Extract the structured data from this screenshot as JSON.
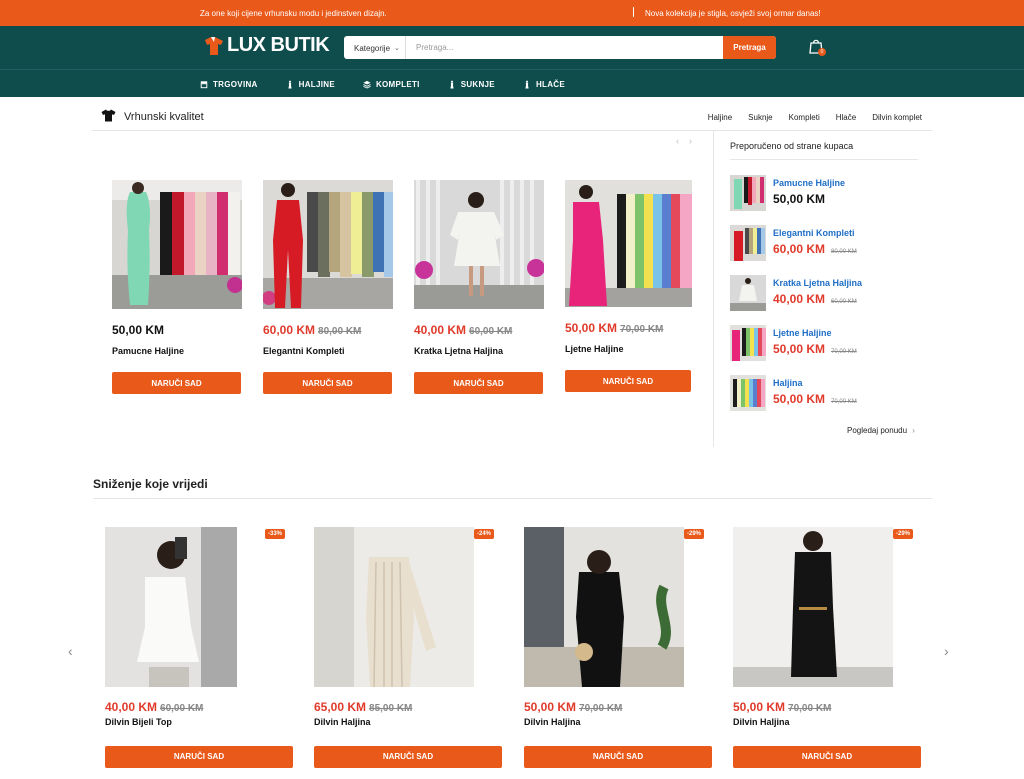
{
  "topbar": {
    "left": "Za one koji cijene vrhunsku modu i jedinstven dizajn.",
    "right": "Nova kolekcija je stigla, osvježi svoj ormar danas!"
  },
  "header": {
    "logo": "LUX BUTIK",
    "category_label": "Kategorije",
    "search_placeholder": "Pretraga...",
    "search_button": "Pretraga",
    "cart_count": "0"
  },
  "nav": {
    "items": [
      "TRGOVINA",
      "HALJINE",
      "KOMPLETI",
      "SUKNJE",
      "HLAČE"
    ]
  },
  "section1": {
    "title": "Vrhunski kvalitet",
    "tabs": [
      "Haljine",
      "Suknje",
      "Kompleti",
      "Hlače",
      "Dilvin komplet"
    ],
    "products": [
      {
        "price": "50,00 KM",
        "old": "",
        "name": "Pamucne Haljine",
        "button": "NARUČI SAD"
      },
      {
        "price": "60,00 KM",
        "old": "80,00 KM",
        "name": "Elegantni Kompleti",
        "button": "NARUČI SAD"
      },
      {
        "price": "40,00 KM",
        "old": "60,00 KM",
        "name": "Kratka Ljetna Haljina",
        "button": "NARUČI SAD"
      },
      {
        "price": "50,00 KM",
        "old": "70,00 KM",
        "name": "Ljetne Haljine",
        "button": "NARUČI SAD"
      }
    ]
  },
  "recommended": {
    "title": "Preporučeno od strane kupaca",
    "items": [
      {
        "name": "Pamucne Haljine",
        "price": "50,00 KM",
        "old": ""
      },
      {
        "name": "Elegantni Kompleti",
        "price": "60,00 KM",
        "old": "80,00 KM"
      },
      {
        "name": "Kratka Ljetna Haljina",
        "price": "40,00 KM",
        "old": "60,00 KM"
      },
      {
        "name": "Ljetne Haljine",
        "price": "50,00 KM",
        "old": "70,00 KM"
      },
      {
        "name": "Haljina",
        "price": "50,00 KM",
        "old": "70,00 KM"
      }
    ],
    "more": "Pogledaj ponudu"
  },
  "section2": {
    "title": "Sniženje koje vrijedi",
    "products": [
      {
        "discount": "-33%",
        "price": "40,00 KM",
        "old": "60,00 KM",
        "name": "Dilvin Bijeli Top",
        "button": "NARUČI SAD"
      },
      {
        "discount": "-24%",
        "price": "65,00 KM",
        "old": "85,00 KM",
        "name": "Dilvin Haljina",
        "button": "NARUČI SAD"
      },
      {
        "discount": "-29%",
        "price": "50,00 KM",
        "old": "70,00 KM",
        "name": "Dilvin Haljina",
        "button": "NARUČI SAD"
      },
      {
        "discount": "-29%",
        "price": "50,00 KM",
        "old": "70,00 KM",
        "name": "Dilvin Haljina",
        "button": "NARUČI SAD"
      }
    ]
  },
  "colors": {
    "accent": "#e8591a",
    "header": "#0f4c4c",
    "sale_price": "#e03a2b",
    "link": "#1f6fc7"
  }
}
